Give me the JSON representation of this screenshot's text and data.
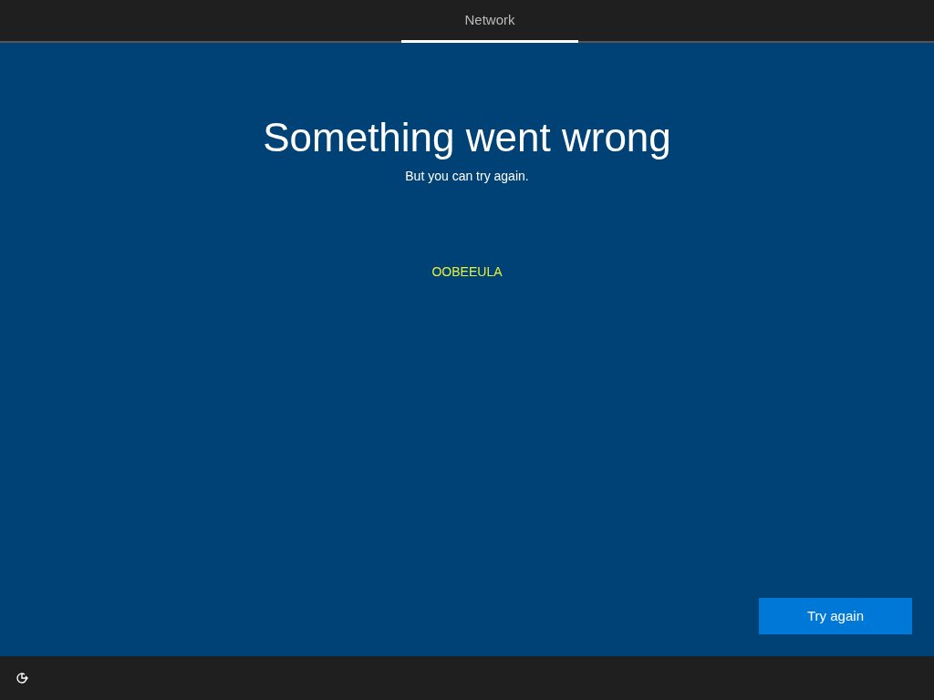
{
  "tabs": [
    {
      "label": "Network",
      "selected": true
    }
  ],
  "heading": "Something went wrong",
  "subheading": "But you can try again.",
  "error_code": "OOBEEULA",
  "buttons": [
    {
      "label": "Try again"
    }
  ]
}
